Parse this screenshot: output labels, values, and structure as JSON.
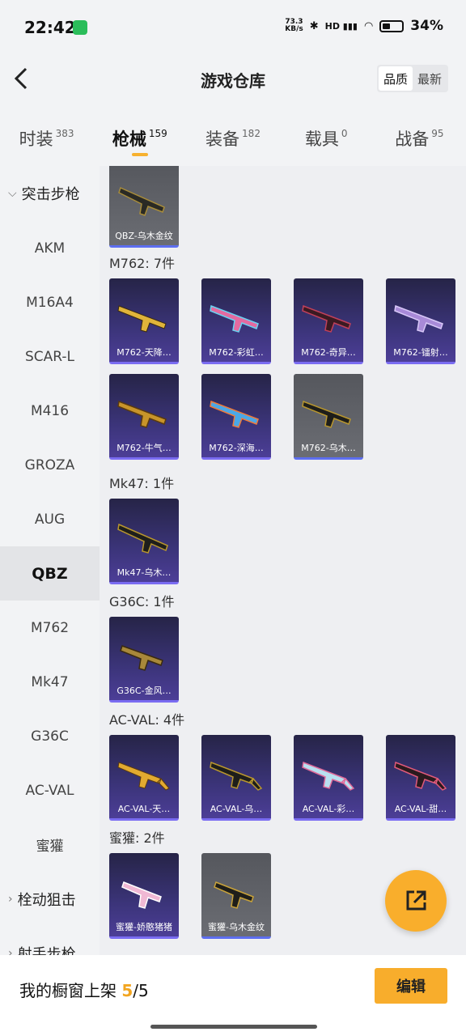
{
  "status": {
    "time": "22:42",
    "speed": "73.3\nKB/s",
    "network": "HD",
    "battery": "34%"
  },
  "header": {
    "title": "游戏仓库",
    "sort_quality": "品质",
    "sort_latest": "最新"
  },
  "tabs": [
    {
      "label": "时装",
      "count": "383"
    },
    {
      "label": "枪械",
      "count": "159"
    },
    {
      "label": "装备",
      "count": "182"
    },
    {
      "label": "载具",
      "count": "0"
    },
    {
      "label": "战备",
      "count": "95"
    }
  ],
  "sidebar": {
    "group_assault": "突击步枪",
    "items": [
      "AKM",
      "M16A4",
      "SCAR-L",
      "M416",
      "GROZA",
      "AUG",
      "QBZ",
      "M762",
      "Mk47",
      "G36C",
      "AC-VAL",
      "蜜獾"
    ],
    "group_sniper": "栓动狙击",
    "group_marksman": "射手步枪"
  },
  "content": {
    "qbz_card": "QBZ-乌木金纹",
    "m762": {
      "title": "M762: 7件",
      "cards": [
        "M762-天降…",
        "M762-彩虹…",
        "M762-奇异…",
        "M762-镭射…",
        "M762-牛气…",
        "M762-深海…",
        "M762-乌木…"
      ]
    },
    "mk47": {
      "title": "Mk47: 1件",
      "cards": [
        "Mk47-乌木…"
      ]
    },
    "g36c": {
      "title": "G36C: 1件",
      "cards": [
        "G36C-金风…"
      ]
    },
    "acval": {
      "title": "AC-VAL: 4件",
      "cards": [
        "AC-VAL-天…",
        "AC-VAL-乌…",
        "AC-VAL-彩…",
        "AC-VAL-甜…"
      ]
    },
    "honeybadger": {
      "title": "蜜獾: 2件",
      "cards": [
        "蜜獾-娇憨猪猪",
        "蜜獾-乌木金纹"
      ]
    }
  },
  "bottom": {
    "showcase_label": "我的橱窗上架 ",
    "showcase_current": "5",
    "showcase_total": "/5",
    "edit": "编辑"
  },
  "colors": {
    "accent": "#f8ad2c",
    "card_bg": "#3b3479",
    "card_border": "#7a6cf2"
  }
}
